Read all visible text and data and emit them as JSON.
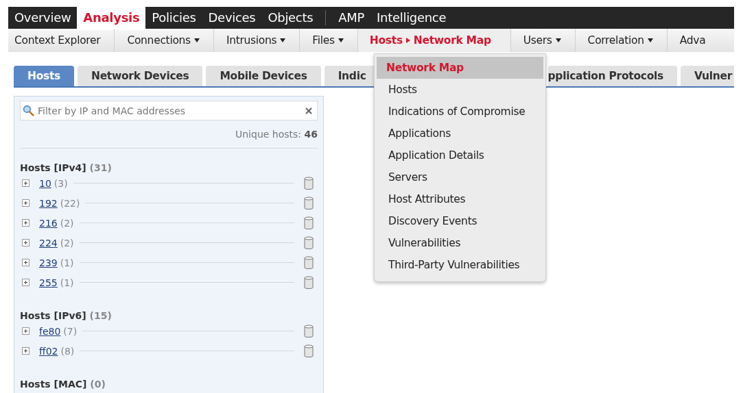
{
  "main_nav": [
    {
      "label": "Overview",
      "selected": false
    },
    {
      "label": "Analysis",
      "selected": true
    },
    {
      "label": "Policies",
      "selected": false
    },
    {
      "label": "Devices",
      "selected": false
    },
    {
      "label": "Objects",
      "selected": false
    },
    {
      "label": "AMP",
      "selected": false,
      "separator_before": true
    },
    {
      "label": "Intelligence",
      "selected": false
    }
  ],
  "sub_nav": [
    {
      "label": "Context Explorer",
      "selected": false,
      "dropdown": false
    },
    {
      "label": "Connections",
      "selected": false,
      "dropdown": true
    },
    {
      "label": "Intrusions",
      "selected": false,
      "dropdown": true
    },
    {
      "label": "Files",
      "selected": false,
      "dropdown": true
    },
    {
      "label": "Hosts",
      "sub_label": "Network Map",
      "selected": true,
      "dropdown": false
    },
    {
      "label": "Users",
      "selected": false,
      "dropdown": true
    },
    {
      "label": "Correlation",
      "selected": false,
      "dropdown": true
    },
    {
      "label": "Adva",
      "selected": false,
      "dropdown": false
    }
  ],
  "dropdown_menu": [
    {
      "label": "Network Map",
      "selected": true
    },
    {
      "label": "Hosts",
      "selected": false
    },
    {
      "label": "Indications of Compromise",
      "selected": false
    },
    {
      "label": "Applications",
      "selected": false
    },
    {
      "label": "Application Details",
      "selected": false
    },
    {
      "label": "Servers",
      "selected": false
    },
    {
      "label": "Host Attributes",
      "selected": false
    },
    {
      "label": "Discovery Events",
      "selected": false
    },
    {
      "label": "Vulnerabilities",
      "selected": false
    },
    {
      "label": "Third-Party Vulnerabilities",
      "selected": false
    }
  ],
  "tabs": [
    {
      "label": "Hosts",
      "selected": true
    },
    {
      "label": "Network Devices",
      "selected": false
    },
    {
      "label": "Mobile Devices",
      "selected": false
    },
    {
      "label": "Indic",
      "selected": false
    },
    {
      "label": "pplication Protocols",
      "selected": false
    },
    {
      "label": "Vulner",
      "selected": false
    }
  ],
  "filter": {
    "placeholder": "Filter by IP and MAC addresses"
  },
  "unique_hosts": {
    "label": "Unique hosts:",
    "value": "46"
  },
  "groups": [
    {
      "title": "Hosts [IPv4]",
      "count": "(31)",
      "children": [
        {
          "label": "10",
          "count": "(3)"
        },
        {
          "label": "192",
          "count": "(22)"
        },
        {
          "label": "216",
          "count": "(2)"
        },
        {
          "label": "224",
          "count": "(2)"
        },
        {
          "label": "239",
          "count": "(1)"
        },
        {
          "label": "255",
          "count": "(1)"
        }
      ]
    },
    {
      "title": "Hosts [IPv6]",
      "count": "(15)",
      "children": [
        {
          "label": "fe80",
          "count": "(7)"
        },
        {
          "label": "ff02",
          "count": "(8)"
        }
      ]
    },
    {
      "title": "Hosts [MAC]",
      "count": "(0)"
    }
  ]
}
